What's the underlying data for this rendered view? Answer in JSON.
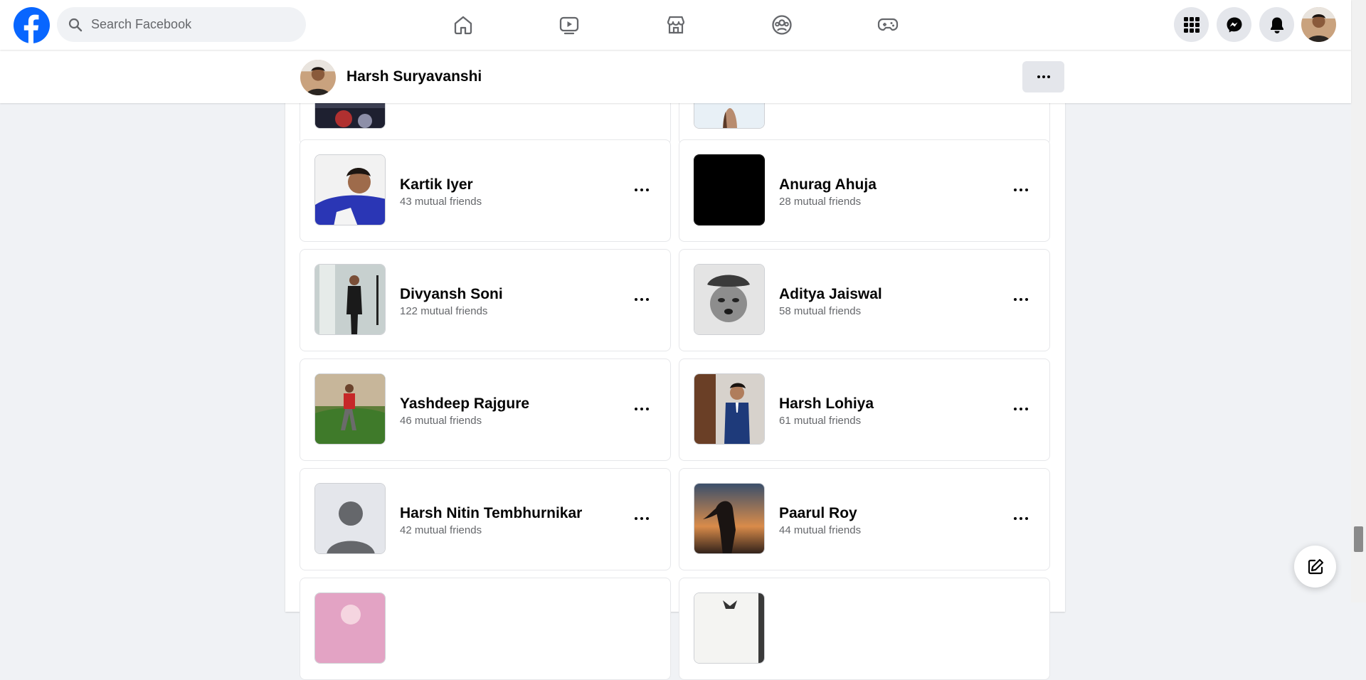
{
  "header": {
    "search_placeholder": "Search Facebook",
    "nav": [
      {
        "name": "home-icon"
      },
      {
        "name": "watch-icon"
      },
      {
        "name": "marketplace-icon"
      },
      {
        "name": "groups-icon"
      },
      {
        "name": "gaming-icon"
      }
    ],
    "right_buttons": [
      "menu-grid-icon",
      "messenger-icon",
      "notifications-icon"
    ]
  },
  "profile": {
    "name": "Harsh Suryavanshi",
    "more_icon": "more-icon"
  },
  "friends": [
    {
      "name": "Kartik Iyer",
      "mutual": "43 mutual friends"
    },
    {
      "name": "Anurag Ahuja",
      "mutual": "28 mutual friends"
    },
    {
      "name": "Divyansh Soni",
      "mutual": "122 mutual friends"
    },
    {
      "name": "Aditya Jaiswal",
      "mutual": "58 mutual friends"
    },
    {
      "name": "Yashdeep Rajgure",
      "mutual": "46 mutual friends"
    },
    {
      "name": "Harsh Lohiya",
      "mutual": "61 mutual friends"
    },
    {
      "name": "Harsh Nitin Tembhurnikar",
      "mutual": "42 mutual friends"
    },
    {
      "name": "Paarul Roy",
      "mutual": "44 mutual friends"
    }
  ],
  "colors": {
    "brand": "#0866ff",
    "page_bg": "#f0f2f5",
    "secondary_text": "#65676b",
    "button_bg": "#e4e6eb"
  }
}
